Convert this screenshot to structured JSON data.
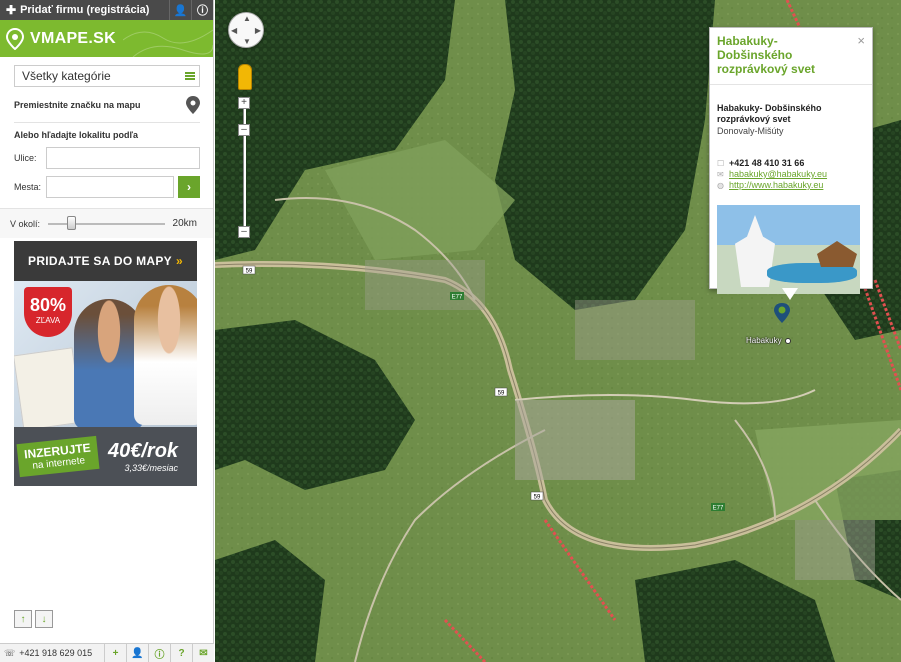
{
  "topbar": {
    "add_company": "Pridať firmu (registrácia)",
    "user_icon": "user-icon",
    "info_icon": "info-icon"
  },
  "brand": {
    "name": "VMAPE.SK",
    "color": "#7dba2f"
  },
  "filters": {
    "category": "Všetky kategórie",
    "move_marker": "Premiestnite značku na mapu",
    "or_search": "Alebo hľadajte lokalitu podľa",
    "street_label": "Ulice:",
    "city_label": "Mesta:",
    "street_value": "",
    "city_value": ""
  },
  "radius": {
    "label": "V okolí:",
    "value": "20km",
    "fraction": 0.2
  },
  "ad": {
    "headline": "PRIDAJTE SA DO MAPY",
    "arrows": "»",
    "badge_pct": "80%",
    "badge_label": "ZĽAVA",
    "cta_line1": "INZERUJTE",
    "cta_line2": "na internete",
    "price": "40€/rok",
    "price_month": "3,33€/mesiac"
  },
  "footer": {
    "phone": "+421 918 629 015"
  },
  "infowindow": {
    "title": "Habakuky- Dobšinského rozprávkový svet",
    "name": "Habakuky- Dobšinského rozprávkový svet",
    "location": "Donovaly-Mišúty",
    "phone": "+421 48 410 31 66",
    "email": "habakuky@habakuky.eu",
    "web": "http://www.habakuky.eu",
    "close": "×"
  },
  "map": {
    "poi_label": "Habakuky",
    "road_labels": [
      "59",
      "E77",
      "59",
      "59",
      "E77"
    ]
  },
  "colors": {
    "accent": "#6aa52b",
    "topbar": "#4a4a4a"
  }
}
